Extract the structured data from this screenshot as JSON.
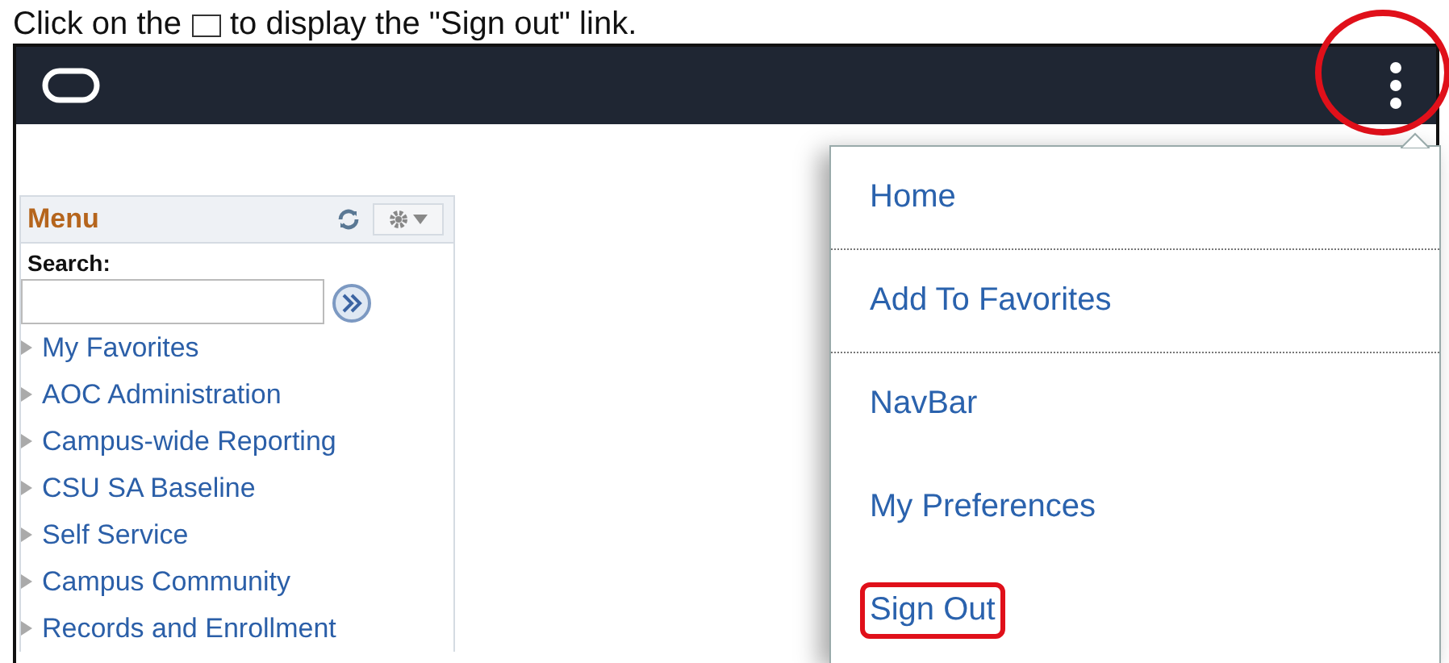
{
  "caption": {
    "before": "Click on the",
    "after": "to display the \"Sign out\" link."
  },
  "header": {
    "actions_highlighted": true
  },
  "menu": {
    "title": "Menu",
    "search_label": "Search:",
    "items": [
      {
        "label": "My Favorites"
      },
      {
        "label": "AOC Administration"
      },
      {
        "label": "Campus-wide Reporting"
      },
      {
        "label": "CSU SA Baseline"
      },
      {
        "label": "Self Service"
      },
      {
        "label": "Campus Community"
      },
      {
        "label": "Records and Enrollment"
      }
    ]
  },
  "dropdown": {
    "items": [
      {
        "label": "Home",
        "divider_after": true,
        "highlighted": false
      },
      {
        "label": "Add To Favorites",
        "divider_after": true,
        "highlighted": false
      },
      {
        "label": "NavBar",
        "divider_after": false,
        "highlighted": false
      },
      {
        "label": "My Preferences",
        "divider_after": false,
        "highlighted": false
      },
      {
        "label": "Sign Out",
        "divider_after": false,
        "highlighted": true
      }
    ]
  }
}
